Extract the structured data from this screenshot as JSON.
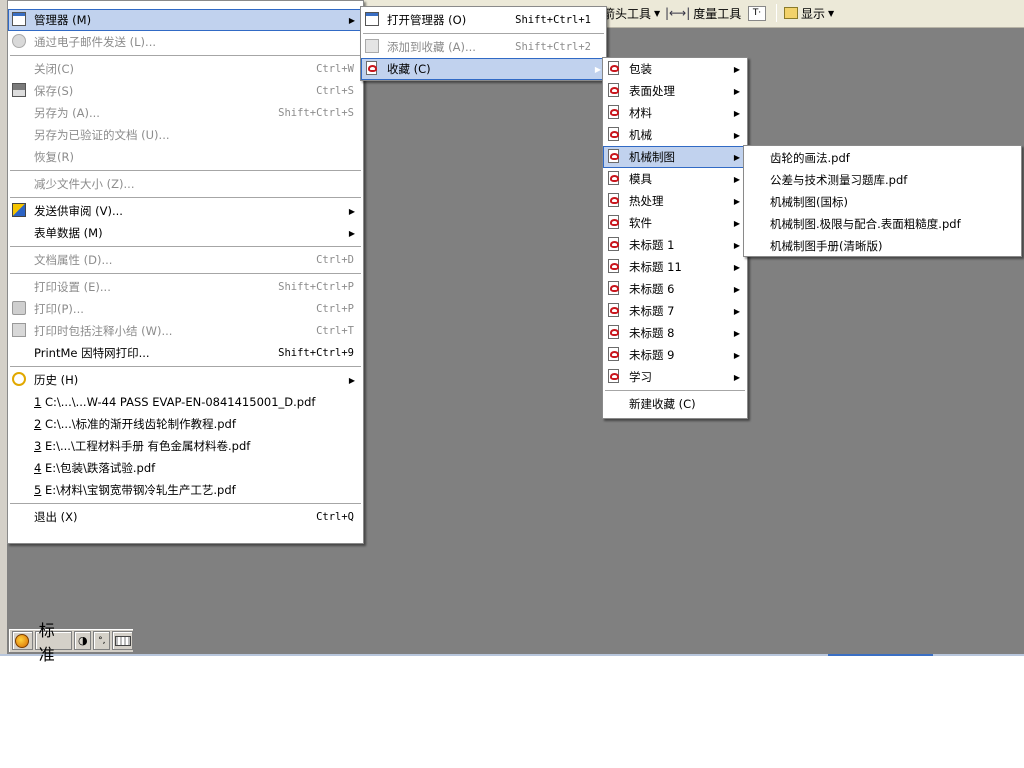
{
  "toolbar": {
    "arrow_tool_label": "箭头工具",
    "measure_tool_label": "度量工具",
    "display_label": "显示"
  },
  "ime_bar": {
    "mode_label": "标准"
  },
  "colors": {
    "menu_highlight": "#c1d2ee",
    "menu_highlight_border": "#316ac5",
    "workspace": "#808080",
    "disabled_text": "#8c8c8c"
  },
  "file_menu": {
    "items": [
      {
        "label": "管理器 (M)",
        "icon": "manager-icon",
        "submenu": true,
        "state": "highlight"
      },
      {
        "label": "通过电子邮件发送 (L)...",
        "icon": "email-icon",
        "state": "disabled"
      },
      {
        "label": "关闭(C)",
        "shortcut": "Ctrl+W",
        "state": "disabled"
      },
      {
        "label": "保存(S)",
        "shortcut": "Ctrl+S",
        "icon": "save-icon",
        "state": "disabled"
      },
      {
        "label": "另存为 (A)...",
        "shortcut": "Shift+Ctrl+S",
        "state": "disabled"
      },
      {
        "label": "另存为已验证的文档 (U)...",
        "state": "disabled"
      },
      {
        "label": "恢复(R)",
        "state": "disabled"
      },
      {
        "label": "减少文件大小 (Z)...",
        "state": "disabled"
      },
      {
        "label": "发送供审阅 (V)...",
        "icon": "send-review-icon",
        "submenu": true
      },
      {
        "label": "表单数据 (M)",
        "submenu": true
      },
      {
        "label": "文档属性 (D)...",
        "shortcut": "Ctrl+D",
        "state": "disabled"
      },
      {
        "label": "打印设置 (E)...",
        "shortcut": "Shift+Ctrl+P",
        "state": "disabled"
      },
      {
        "label": "打印(P)...",
        "shortcut": "Ctrl+P",
        "icon": "printer-icon",
        "state": "disabled"
      },
      {
        "label": "打印时包括注释小结 (W)...",
        "shortcut": "Ctrl+T",
        "icon": "comment-icon",
        "state": "disabled"
      },
      {
        "label": "PrintMe 因特网打印...",
        "shortcut": "Shift+Ctrl+9"
      },
      {
        "label": "历史 (H)",
        "icon": "history-icon",
        "submenu": true
      },
      {
        "num": "1",
        "label": " C:\\...\\...W-44 PASS EVAP-EN-0841415001_D.pdf"
      },
      {
        "num": "2",
        "label": " C:\\...\\标准的渐开线齿轮制作教程.pdf"
      },
      {
        "num": "3",
        "label": " E:\\...\\工程材料手册  有色金属材料卷.pdf"
      },
      {
        "num": "4",
        "label": " E:\\包装\\跌落试验.pdf"
      },
      {
        "num": "5",
        "label": " E:\\材料\\宝钢宽带钢冷轧生产工艺.pdf"
      },
      {
        "label": "退出 (X)",
        "shortcut": "Ctrl+Q"
      }
    ]
  },
  "manager_menu": {
    "items": [
      {
        "label": "打开管理器 (O)",
        "shortcut": "Shift+Ctrl+1",
        "icon": "manager-icon"
      },
      {
        "label": "添加到收藏 (A)...",
        "shortcut": "Shift+Ctrl+2",
        "icon": "add-favorite-icon",
        "state": "disabled"
      },
      {
        "label": "收藏 (C)",
        "icon": "pdf-icon",
        "submenu": true,
        "state": "highlight"
      }
    ]
  },
  "favorites_menu": {
    "items": [
      {
        "label": "包装"
      },
      {
        "label": "表面处理"
      },
      {
        "label": "材料"
      },
      {
        "label": "机械"
      },
      {
        "label": "机械制图",
        "state": "highlight"
      },
      {
        "label": "模具"
      },
      {
        "label": "热处理"
      },
      {
        "label": "软件"
      },
      {
        "label": "未标题 1"
      },
      {
        "label": "未标题 11"
      },
      {
        "label": "未标题 6"
      },
      {
        "label": "未标题 7"
      },
      {
        "label": "未标题 8"
      },
      {
        "label": "未标题 9"
      },
      {
        "label": "学习"
      }
    ],
    "new_favorite_label": "新建收藏 (C)"
  },
  "mech_drawing_menu": {
    "items": [
      {
        "label": "齿轮的画法.pdf"
      },
      {
        "label": "公差与技术测量习题库.pdf"
      },
      {
        "label": "机械制图(国标)"
      },
      {
        "label": "机械制图.极限与配合.表面粗糙度.pdf"
      },
      {
        "label": "机械制图手册(清晰版)"
      }
    ]
  }
}
